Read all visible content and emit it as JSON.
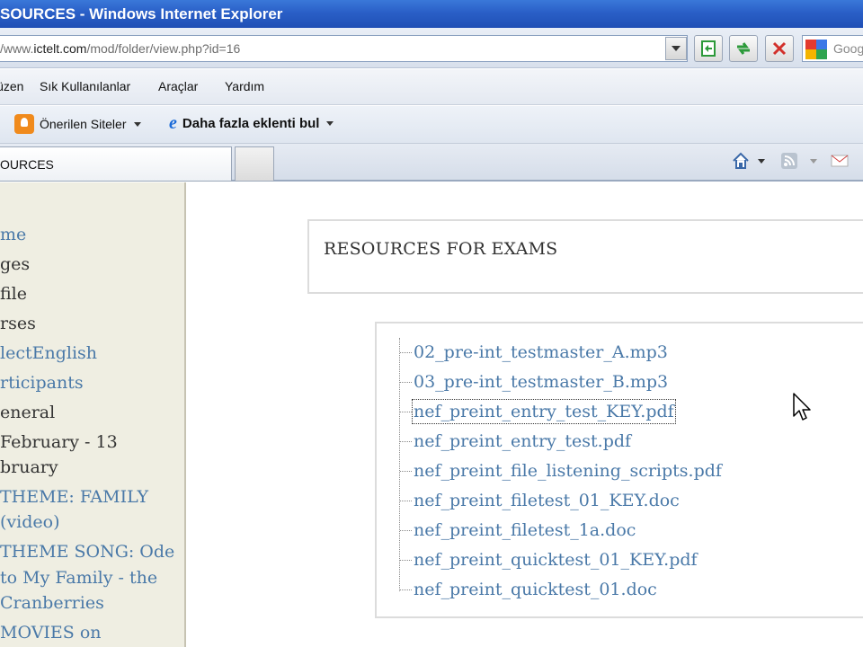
{
  "window": {
    "title": "SOURCES - Windows Internet Explorer"
  },
  "address_bar": {
    "url_prefix": "/www.",
    "url_domain": "ictelt.com",
    "url_path": "/mod/folder/view.php?id=16",
    "search_placeholder": "Goog"
  },
  "menu": {
    "items": [
      "Düzen",
      "Sık Kullanılanlar",
      "Araçlar",
      "Yardım"
    ],
    "visible_items": [
      "Düzen",
      "Sık Kullanılanlar",
      "Araçlar",
      "Yardım"
    ]
  },
  "favorites_bar": {
    "suggested_sites": "Önerilen Siteler",
    "more_addons": "Daha fazla eklenti bul"
  },
  "tab": {
    "label": "OURCES"
  },
  "sidebar": {
    "items": [
      {
        "text": "me",
        "kind": "link"
      },
      {
        "text": "ges",
        "kind": "text"
      },
      {
        "text": "file",
        "kind": "text"
      },
      {
        "text": "rses",
        "kind": "text"
      },
      {
        "text": "lectEnglish",
        "kind": "link"
      },
      {
        "text": "rticipants",
        "kind": "link"
      },
      {
        "text": "eneral",
        "kind": "text"
      },
      {
        "text": "February - 13",
        "kind": "text"
      },
      {
        "text": "bruary",
        "kind": "text"
      },
      {
        "text": "THEME: FAMILY",
        "kind": "link"
      },
      {
        "text": "(video)",
        "kind": "link"
      },
      {
        "text": "THEME SONG: Ode",
        "kind": "link"
      },
      {
        "text": "to My Family - the",
        "kind": "link"
      },
      {
        "text": "Cranberries",
        "kind": "link"
      },
      {
        "text": "MOVIES on",
        "kind": "link"
      }
    ]
  },
  "content": {
    "heading": "RESOURCES FOR EXAMS",
    "files": [
      "02_pre-int_testmaster_A.mp3",
      "03_pre-int_testmaster_B.mp3",
      "nef_preint_entry_test_KEY.pdf",
      "nef_preint_entry_test.pdf",
      "nef_preint_file_listening_scripts.pdf",
      "nef_preint_filetest_01_KEY.doc",
      "nef_preint_filetest_1a.doc",
      "nef_preint_quicktest_01_KEY.pdf",
      "nef_preint_quicktest_01.doc"
    ],
    "focused_file_index": 2
  },
  "colors": {
    "link": "#4a79a8",
    "sidebar_bg": "#efeee2",
    "titlebar": "#2a5fc7"
  }
}
